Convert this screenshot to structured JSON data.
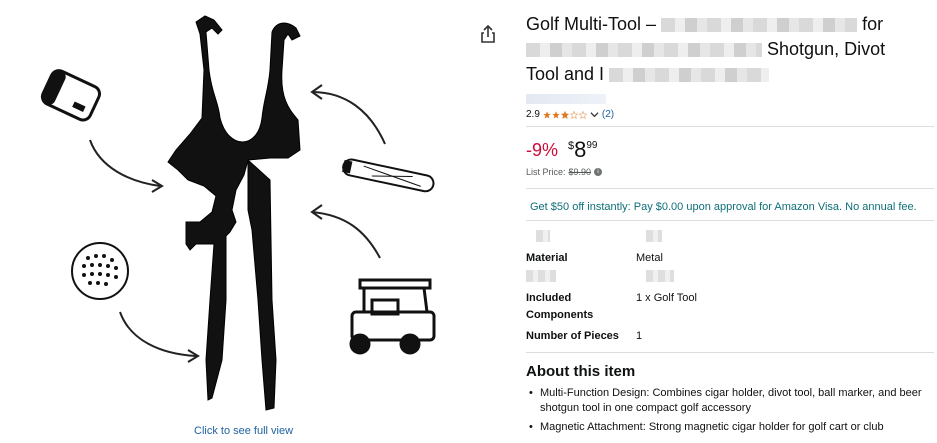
{
  "product": {
    "title_start": "Golf Multi-Tool –",
    "title_for": "for",
    "title_line2": "Shotgun, Divot",
    "title_line3": "Tool and I",
    "rating_value": "2.9",
    "rating_stars": 2.9,
    "rating_count": "(2)",
    "discount": "-9%",
    "price_symbol": "$",
    "price_whole": "8",
    "price_fraction": "99",
    "list_price_label": "List Price:",
    "list_price_value": "$9.90",
    "promo_text": "Get $50 off instantly: Pay $0.00 upon approval for Amazon Visa. No annual fee.",
    "specs": [
      {
        "label": "Material",
        "value": "Metal"
      },
      {
        "label_line1": "Included",
        "label_line2": "Components",
        "value": "1 x Golf Tool"
      },
      {
        "label": "Number of Pieces",
        "value": "1"
      }
    ],
    "about_heading": "About this item",
    "bullets": [
      "Multi-Function Design: Combines cigar holder, divot tool, ball marker, and beer shotgun tool in one compact golf accessory",
      "Magnetic Attachment: Strong magnetic cigar holder for golf cart or club"
    ]
  },
  "image": {
    "caption": "Click to see full view",
    "icons": [
      "can-icon",
      "cigar-icon",
      "golf-ball-icon",
      "golf-cart-icon",
      "share-icon"
    ]
  },
  "colors": {
    "price_red": "#cc0c39",
    "link_blue": "#2162a1",
    "promo_teal": "#0f6f78",
    "star_orange": "#de7921"
  }
}
